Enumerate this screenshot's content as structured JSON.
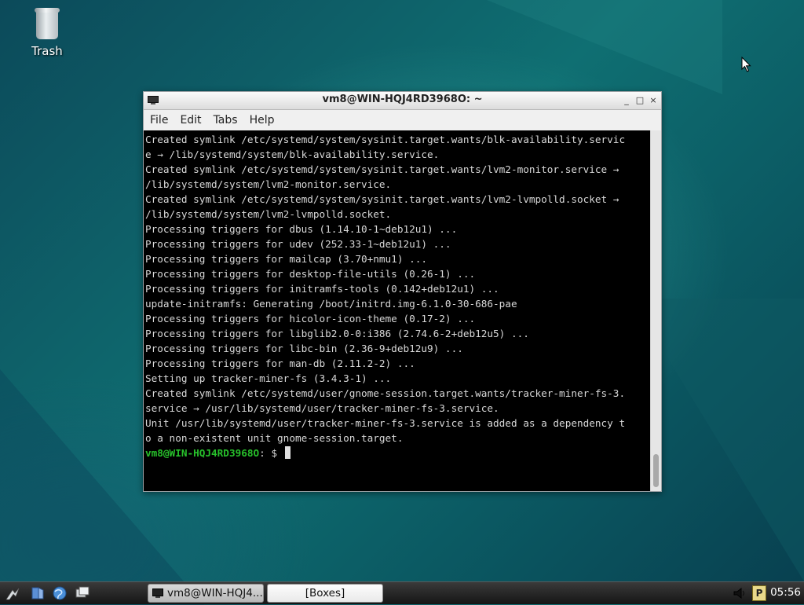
{
  "desktop": {
    "trash_label": "Trash"
  },
  "window": {
    "title": "vm8@WIN-HQJ4RD3968O: ~",
    "controls": {
      "minimize": "_",
      "maximize": "□",
      "close": "×"
    },
    "menu": [
      "File",
      "Edit",
      "Tabs",
      "Help"
    ]
  },
  "terminal": {
    "lines": [
      "Created symlink /etc/systemd/system/sysinit.target.wants/blk-availability.servic",
      "e → /lib/systemd/system/blk-availability.service.",
      "Created symlink /etc/systemd/system/sysinit.target.wants/lvm2-monitor.service →",
      "/lib/systemd/system/lvm2-monitor.service.",
      "Created symlink /etc/systemd/system/sysinit.target.wants/lvm2-lvmpolld.socket →",
      "/lib/systemd/system/lvm2-lvmpolld.socket.",
      "Processing triggers for dbus (1.14.10-1~deb12u1) ...",
      "Processing triggers for udev (252.33-1~deb12u1) ...",
      "Processing triggers for mailcap (3.70+nmu1) ...",
      "Processing triggers for desktop-file-utils (0.26-1) ...",
      "Processing triggers for initramfs-tools (0.142+deb12u1) ...",
      "update-initramfs: Generating /boot/initrd.img-6.1.0-30-686-pae",
      "Processing triggers for hicolor-icon-theme (0.17-2) ...",
      "Processing triggers for libglib2.0-0:i386 (2.74.6-2+deb12u5) ...",
      "Processing triggers for libc-bin (2.36-9+deb12u9) ...",
      "Processing triggers for man-db (2.11.2-2) ...",
      "Setting up tracker-miner-fs (3.4.3-1) ...",
      "Created symlink /etc/systemd/user/gnome-session.target.wants/tracker-miner-fs-3.",
      "service → /usr/lib/systemd/user/tracker-miner-fs-3.service.",
      "Unit /usr/lib/systemd/user/tracker-miner-fs-3.service is added as a dependency t",
      "o a non-existent unit gnome-session.target."
    ],
    "prompt_user": "vm8@WIN-HQJ4RD3968O",
    "prompt_rest": ": $ "
  },
  "taskbar": {
    "tasks": [
      {
        "label": "vm8@WIN-HQJ4..."
      },
      {
        "label": "[Boxes]"
      }
    ],
    "tray_p": "P",
    "clock": "05:56"
  },
  "colors": {
    "prompt": "#27c12b",
    "terminal_bg": "#000000",
    "terminal_fg": "#d8d8d8"
  }
}
